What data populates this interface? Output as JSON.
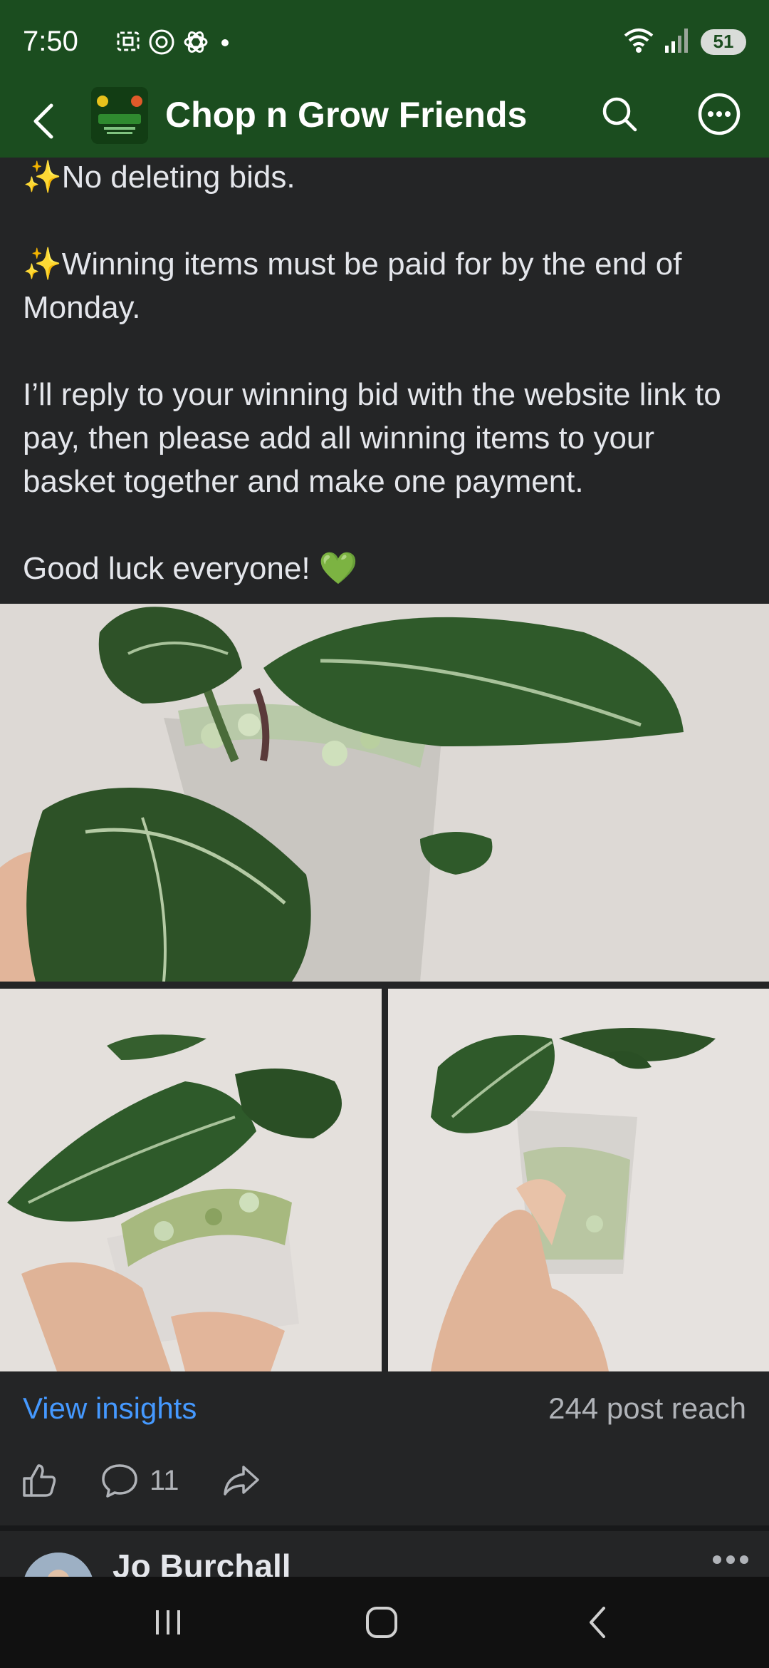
{
  "status_bar": {
    "time": "7:50",
    "battery": "51",
    "icons": [
      "screenshot-icon",
      "threads-icon",
      "chatgpt-icon",
      "dot-icon",
      "wifi-icon",
      "signal-icon"
    ]
  },
  "header": {
    "title": "Chop n Grow Friends",
    "avatar_text": "Friends"
  },
  "post": {
    "lines": [
      {
        "prefix": "✨",
        "text": "No deleting bids."
      },
      {
        "prefix": "✨",
        "text": "Winning items must be paid for by the end of Monday."
      },
      {
        "prefix": "",
        "text": "I’ll reply to your winning bid with the website link to pay, then please add all winning items to your basket together and make one payment."
      },
      {
        "prefix": "",
        "text": "Good luck everyone! ",
        "suffix": "💚"
      }
    ]
  },
  "insights": {
    "link_label": "View insights",
    "reach": "244 post reach"
  },
  "actions": {
    "comment_count": "11"
  },
  "next_comment": {
    "name": "Jo Burchall"
  },
  "colors": {
    "header_bg": "#1b4d1f",
    "page_bg": "#242526",
    "link": "#4599ff"
  }
}
